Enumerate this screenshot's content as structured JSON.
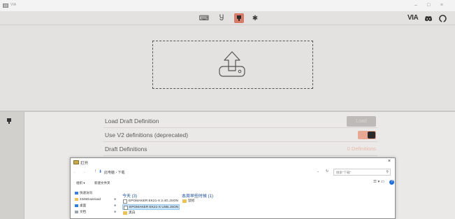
{
  "window": {
    "title": "VIA",
    "controls": [
      "–",
      "□",
      "×"
    ]
  },
  "toolbar": {
    "icons": [
      {
        "name": "keyboard-icon",
        "glyph": "⌨",
        "active": false
      },
      {
        "name": "key-tester-icon",
        "glyph": "Ⴘ",
        "active": false
      },
      {
        "name": "design-icon",
        "glyph": "▼",
        "active": true
      },
      {
        "name": "settings-icon",
        "glyph": "✱",
        "active": false
      }
    ],
    "brand": "VIA",
    "right_icons": [
      {
        "name": "discord-icon",
        "glyph": "◉"
      },
      {
        "name": "github-icon",
        "glyph": "◯"
      }
    ]
  },
  "upload": {
    "icon": "upload-icon"
  },
  "design_panel": {
    "rows": [
      {
        "label": "Load Draft Definition",
        "control": "button",
        "button_label": "Load"
      },
      {
        "label": "Use V2 definitions (deprecated)",
        "control": "toggle",
        "on": true
      },
      {
        "label": "Draft Definitions",
        "control": "text",
        "value": "0 Definitions"
      }
    ]
  },
  "file_dialog": {
    "title": "打开",
    "close": "×",
    "path": "此电脑  ›  下载",
    "search_placeholder": "搜索\"下载\"",
    "organize": "组织 ▾",
    "new_folder": "新建文件夹",
    "quick_access": [
      {
        "label": "快速访问",
        "color": "#3b7dd8"
      },
      {
        "label": "2345Download",
        "color": "#e9c25a"
      },
      {
        "label": "桌面",
        "color": "#2f7fd6"
      },
      {
        "label": "文档",
        "color": "#9aa3ad"
      }
    ],
    "groups": [
      {
        "title": "今天 (3)"
      },
      {
        "title": "本周早些时候 (1)"
      }
    ],
    "files_today": [
      {
        "name": "EPOMAKER EK21-X 2.4G.JSON",
        "selected": false
      },
      {
        "name": "EPOMAKER EK21-X USB.JSON",
        "selected": true
      },
      {
        "name": "黑白",
        "folder": true
      }
    ],
    "files_earlier": [
      {
        "name": "鼠标",
        "folder": true
      }
    ]
  },
  "colors": {
    "accent": "#d97b69",
    "toggle_bg": "#e8a793",
    "background": "#e4e2e0"
  }
}
